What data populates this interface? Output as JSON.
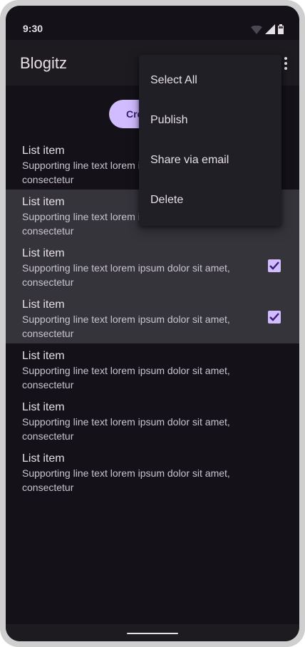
{
  "status_bar": {
    "time": "9:30"
  },
  "app_bar": {
    "title": "Blogitz",
    "overflow_icon": "more-vert-icon"
  },
  "create_button": {
    "label": "Create"
  },
  "list": {
    "items": [
      {
        "title": "List item",
        "supporting": "Supporting line text lorem ipsum dolor sit amet, consectetur",
        "selected": false,
        "checked": false
      },
      {
        "title": "List item",
        "supporting": "Supporting line text lorem ipsum dolor sit amet, consectetur",
        "selected": true,
        "checked": true
      },
      {
        "title": "List item",
        "supporting": "Supporting line text lorem ipsum dolor sit amet, consectetur",
        "selected": true,
        "checked": true
      },
      {
        "title": "List item",
        "supporting": "Supporting line text lorem ipsum dolor sit amet, consectetur",
        "selected": true,
        "checked": true
      },
      {
        "title": "List item",
        "supporting": "Supporting line text lorem ipsum dolor sit amet, consectetur",
        "selected": false,
        "checked": false
      },
      {
        "title": "List item",
        "supporting": "Supporting line text lorem ipsum dolor sit amet, consectetur",
        "selected": false,
        "checked": false
      },
      {
        "title": "List item",
        "supporting": "Supporting line text lorem ipsum dolor sit amet, consectetur",
        "selected": false,
        "checked": false
      }
    ]
  },
  "menu": {
    "items": [
      {
        "label": "Select All"
      },
      {
        "label": "Publish"
      },
      {
        "label": "Share via email"
      },
      {
        "label": "Delete"
      }
    ]
  },
  "colors": {
    "background": "#141218",
    "surface": "#1d1b20",
    "selected_row": "#36343b",
    "primary": "#d0bcff",
    "on_surface": "#e6e1e5",
    "on_surface_variant": "#cac4d0"
  }
}
